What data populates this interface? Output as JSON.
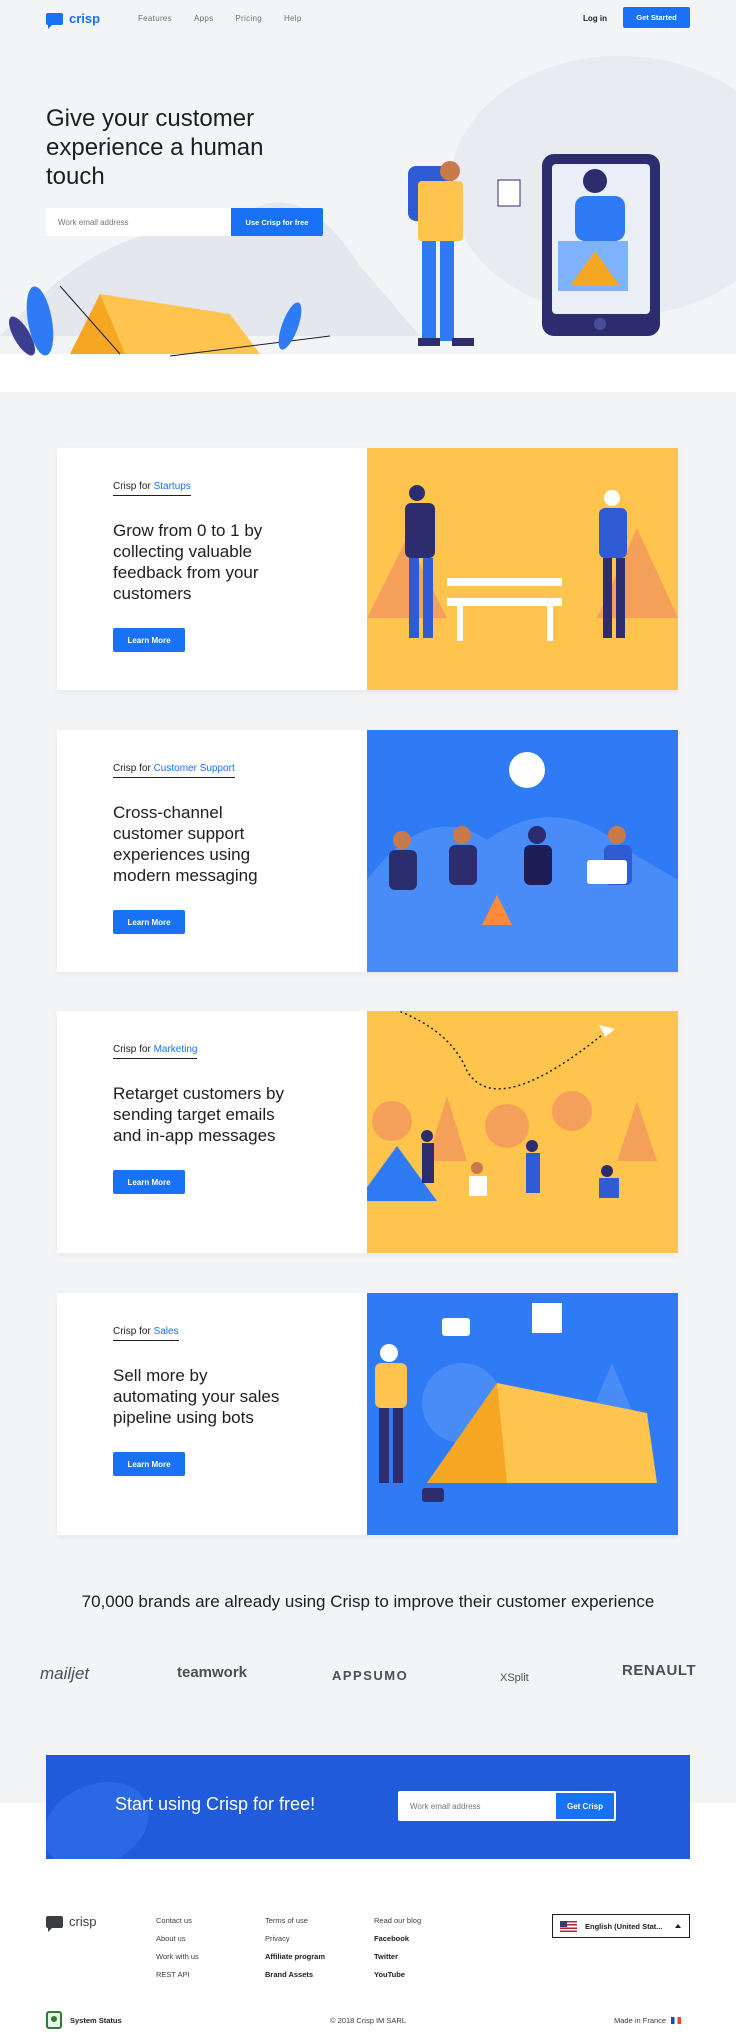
{
  "nav": {
    "logo": "crisp",
    "links": [
      "Features",
      "Apps",
      "Pricing",
      "Help"
    ],
    "login": "Log in",
    "cta": "Get Started"
  },
  "hero": {
    "title": "Give your customer experience a human touch",
    "input_placeholder": "Work email address",
    "button": "Use Crisp for free"
  },
  "cards": [
    {
      "prefix": "Crisp for",
      "segment": "Startups",
      "heading": "Grow from 0 to 1 by collecting valuable feedback from your customers",
      "button": "Learn More",
      "art_bg": "#ffc44d"
    },
    {
      "prefix": "Crisp for",
      "segment": "Customer Support",
      "heading": "Cross-channel customer support experiences using modern messaging",
      "button": "Learn More",
      "art_bg": "#2f7bf5"
    },
    {
      "prefix": "Crisp for",
      "segment": "Marketing",
      "heading": "Retarget customers by sending target emails and in-app messages",
      "button": "Learn More",
      "art_bg": "#ffc44d"
    },
    {
      "prefix": "Crisp for",
      "segment": "Sales",
      "heading": "Sell more by automating your sales pipeline using bots",
      "button": "Learn More",
      "art_bg": "#2f7bf5"
    }
  ],
  "brands": {
    "title": "70,000 brands are already using Crisp to improve their customer experience",
    "logos": [
      "mailjet",
      "teamwork",
      "APPSUMO",
      "XSplit",
      "RENAULT"
    ]
  },
  "cta": {
    "title": "Start using Crisp for free!",
    "input_placeholder": "Work email address",
    "button": "Get Crisp"
  },
  "footer": {
    "logo": "crisp",
    "col1": [
      "Contact us",
      "About us",
      "Work with us",
      "REST API"
    ],
    "col2": [
      "Terms of use",
      "Privacy",
      "Affiliate program",
      "Brand Assets"
    ],
    "col3": [
      "Read our blog",
      "Facebook",
      "Twitter",
      "YouTube"
    ],
    "language": "English (United Stat...",
    "status": "System Status",
    "copyright": "© 2018 Crisp IM SARL",
    "made_in": "Made in France"
  },
  "colors": {
    "brand": "#1972f5",
    "yellow": "#ffc44d",
    "blue": "#2f7bf5"
  }
}
